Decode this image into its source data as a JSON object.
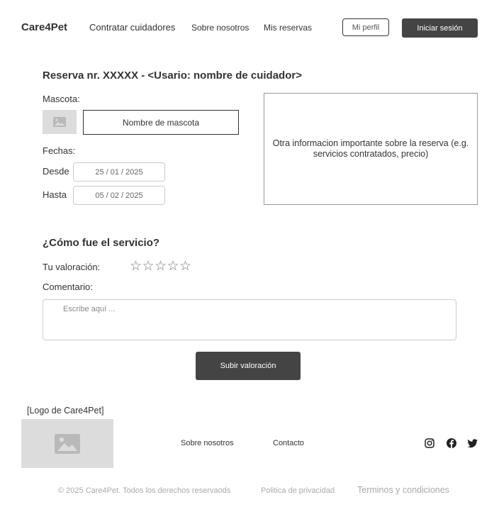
{
  "header": {
    "brand": "Care4Pet",
    "nav": {
      "hire": "Contratar cuidadores",
      "about": "Sobre nosotros",
      "bookings": "Mis reservas"
    },
    "profile_button": "Mi perfil",
    "login_button": "Iniciar sesión"
  },
  "reservation": {
    "title": "Reserva nr. XXXXX - <Usario: nombre de cuidador>",
    "pet_label": "Mascota:",
    "pet_name": "Nombre de mascota",
    "dates_label": "Fechas:",
    "from_label": "Desde",
    "from_value": "25 / 01 / 2025",
    "to_label": "Hasta",
    "to_value": "05 / 02 / 2025",
    "info_text": "Otra informacion importante sobre la reserva (e.g. servicios contratados, precio)"
  },
  "review": {
    "title": "¿Cómo fue el servicio?",
    "rating_label": "Tu valoración:",
    "rating_value": 0,
    "rating_max": 5,
    "comment_label": "Comentario:",
    "comment_placeholder": "Escribe aquí ...",
    "submit_button": "Subir valoración"
  },
  "footer": {
    "logo_label": "[Logo de Care4Pet]",
    "links": {
      "about": "Sobre nosotros",
      "contact": "Contacto"
    },
    "social": [
      "instagram-icon",
      "facebook-icon",
      "twitter-icon"
    ],
    "copyright": "© 2025 Care4Pet. Todos los derechos reservaods",
    "privacy": "Politica de privacidad",
    "terms": "Terminos y condiciones"
  },
  "colors": {
    "dark_button": "#444444",
    "text": "#333333",
    "muted": "#aaaaaa",
    "placeholder_bg": "#dcdcdc"
  }
}
